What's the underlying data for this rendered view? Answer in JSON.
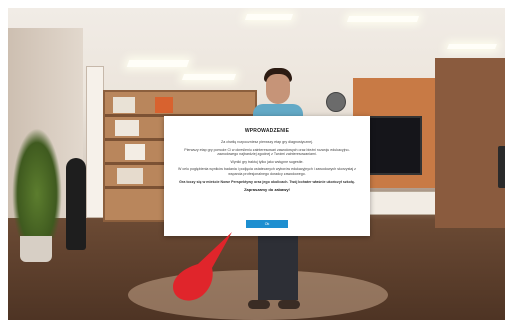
{
  "dialog": {
    "title": "WPROWADZENIE",
    "paragraphs": [
      "Za chwilę rozpoczniesz pierwszy etap gry diagnostycznej.",
      "Pierwszy etap gry pomoże Ci w określeniu zainteresowań zawodowych oraz bieżni rozwoju edukacyjno-zawodowego najbardziej zgodnej z Twoimi zainteresowaniami.",
      "Wyniki gry traktuj tylko jako wstępne sugestie.",
      "W celu pogłębienia wyników badania i podjęcia ostatecznych wyborów edukacyjnych i zawodowych skorzystaj z wsparcia profesjonalnego doradcy zawodowego.",
      "Gra toczy się w mieście Nowe Perspektywy oraz jego okolicach. Twój bohater właśnie ukończył szkołę."
    ],
    "closing": "Zapraszamy do zabawy!",
    "ok_label": "Ok"
  },
  "colors": {
    "button": "#1e8fd0",
    "pointer": "#e0252b"
  },
  "icons": {
    "pointer": "red-teardrop-pointer"
  }
}
